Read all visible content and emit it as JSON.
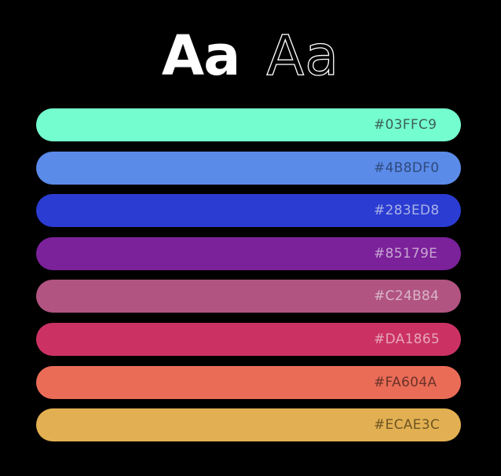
{
  "specimen": {
    "bold_sample": "Aa",
    "light_sample": "Aa"
  },
  "swatches": [
    {
      "hex": "#03FFC9",
      "color": "#74FDCF",
      "text_color": "#3D5F57"
    },
    {
      "hex": "#4B8DF0",
      "color": "#5B8BE9",
      "text_color": "#2F4A7C"
    },
    {
      "hex": "#283ED8",
      "color": "#2B3CD2",
      "text_color": "#A9B2E8"
    },
    {
      "hex": "#85179E",
      "color": "#7B219A",
      "text_color": "#C7A6D3"
    },
    {
      "hex": "#C24B84",
      "color": "#B15482",
      "text_color": "#D8B4C6"
    },
    {
      "hex": "#DA1865",
      "color": "#CB3263",
      "text_color": "#E6A6BA"
    },
    {
      "hex": "#FA604A",
      "color": "#EA6C57",
      "text_color": "#6B3228"
    },
    {
      "hex": "#ECAE3C",
      "color": "#E2B052",
      "text_color": "#6E5523"
    }
  ]
}
